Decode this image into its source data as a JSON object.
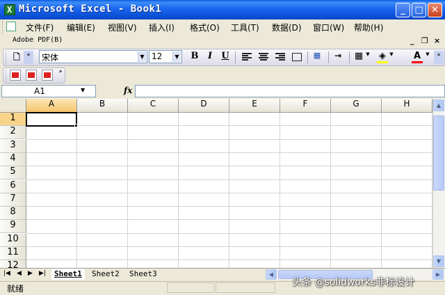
{
  "window": {
    "title": "Microsoft Excel - Book1",
    "minimize_glyph": "_",
    "maximize_glyph": "□",
    "close_glyph": "✕"
  },
  "menu": {
    "items": [
      "文件(F)",
      "编辑(E)",
      "视图(V)",
      "插入(I)",
      "格式(O)",
      "工具(T)",
      "数据(D)",
      "窗口(W)",
      "帮助(H)"
    ],
    "doc_minimize": "_",
    "doc_restore": "❐",
    "doc_close": "×"
  },
  "pdf_menu": {
    "label": "Adobe PDF(B)"
  },
  "format_toolbar": {
    "font_name": "宋体",
    "font_size": "12",
    "bold": "B",
    "italic": "I",
    "underline": "U",
    "font_color_letter": "A",
    "fill_color": "#ffff00",
    "font_color": "#ff0000"
  },
  "formula_bar": {
    "name_box": "A1",
    "fx_label": "fx",
    "formula": ""
  },
  "sheet": {
    "columns": [
      "A",
      "B",
      "C",
      "D",
      "E",
      "F",
      "G",
      "H"
    ],
    "rows": [
      "1",
      "2",
      "3",
      "4",
      "5",
      "6",
      "7",
      "8",
      "9",
      "10",
      "11",
      "12"
    ],
    "active_column": "A",
    "active_row": "1",
    "active_header_color": "#f5c46a"
  },
  "tabs": {
    "nav": [
      "|◀",
      "◀",
      "▶",
      "▶|"
    ],
    "sheets": [
      "Sheet1",
      "Sheet2",
      "Sheet3"
    ],
    "active": "Sheet1"
  },
  "status": {
    "text": "就绪",
    "watermark": "头条 @solidworks非标设计"
  }
}
